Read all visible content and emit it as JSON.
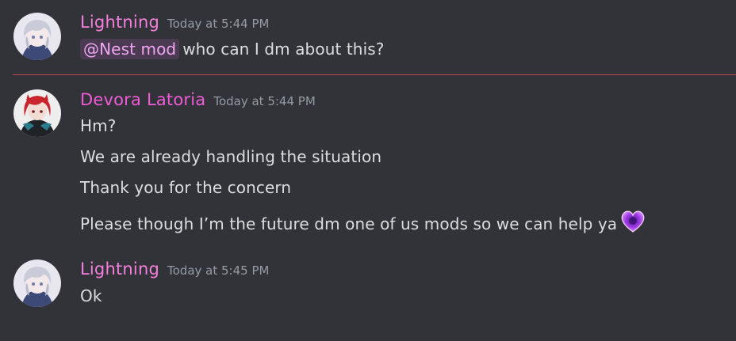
{
  "colors": {
    "background": "#313338",
    "lightning_name": "#f47fdc",
    "devora_name": "#f05bd8",
    "timestamp": "#949ba4",
    "message_text": "#dbdee1",
    "new_divider": "#c0465a",
    "mention_bg": "#4a3a52",
    "mention_text": "#f0a6f3",
    "heart_emoji": "#a13ae6"
  },
  "messages": [
    {
      "author": "Lightning",
      "timestamp": "Today at 5:44 PM",
      "avatar_icon": "silver-haired-anime-avatar-icon",
      "lines": [
        {
          "mention": "@Nest mod",
          "text": "who can I dm about this?"
        }
      ]
    },
    {
      "author": "Devora Latoria",
      "timestamp": "Today at 5:44 PM",
      "avatar_icon": "red-haired-anime-avatar-icon",
      "lines": [
        {
          "text": "Hm?"
        },
        {
          "text": "We are already handling the situation"
        },
        {
          "text": "Thank you for the concern"
        },
        {
          "text": "Please though I’m the future dm one of us mods so we can help ya",
          "emoji": "purple-heart-emoji-icon"
        }
      ]
    },
    {
      "author": "Lightning",
      "timestamp": "Today at 5:45 PM",
      "avatar_icon": "silver-haired-anime-avatar-icon",
      "lines": [
        {
          "text": "Ok"
        }
      ]
    }
  ]
}
